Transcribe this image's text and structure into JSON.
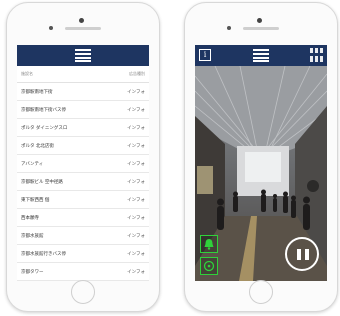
{
  "left_screen": {
    "list_header": {
      "name_col": "施設名",
      "type_col": "広告種別"
    },
    "rows": [
      {
        "name": "京都駅南地下街",
        "info": "インフォ"
      },
      {
        "name": "京都駅南地下街バス停",
        "info": "インフォ"
      },
      {
        "name": "ポルタ ダイニングスロ",
        "info": "インフォ"
      },
      {
        "name": "ポルタ 北北店街",
        "info": "インフォ"
      },
      {
        "name": "アバンティ",
        "info": "インフォ"
      },
      {
        "name": "京都駅ビル 空中径路",
        "info": "インフォ"
      },
      {
        "name": "東下駅西西 個",
        "info": "インフォ"
      },
      {
        "name": "西本願寺",
        "info": "インフォ"
      },
      {
        "name": "京都水族館",
        "info": "インフォ"
      },
      {
        "name": "京都水族館行きバス停",
        "info": "インフォ"
      },
      {
        "name": "京都タワー",
        "info": "インフォ"
      }
    ]
  },
  "right_screen": {
    "info_glyph": "i",
    "icons": [
      "info-icon",
      "list-icon",
      "qr-code-icon",
      "bell-icon",
      "target-icon",
      "pause-icon"
    ],
    "accent_color": "#2fd13a",
    "navbar_color": "#1e3561"
  }
}
